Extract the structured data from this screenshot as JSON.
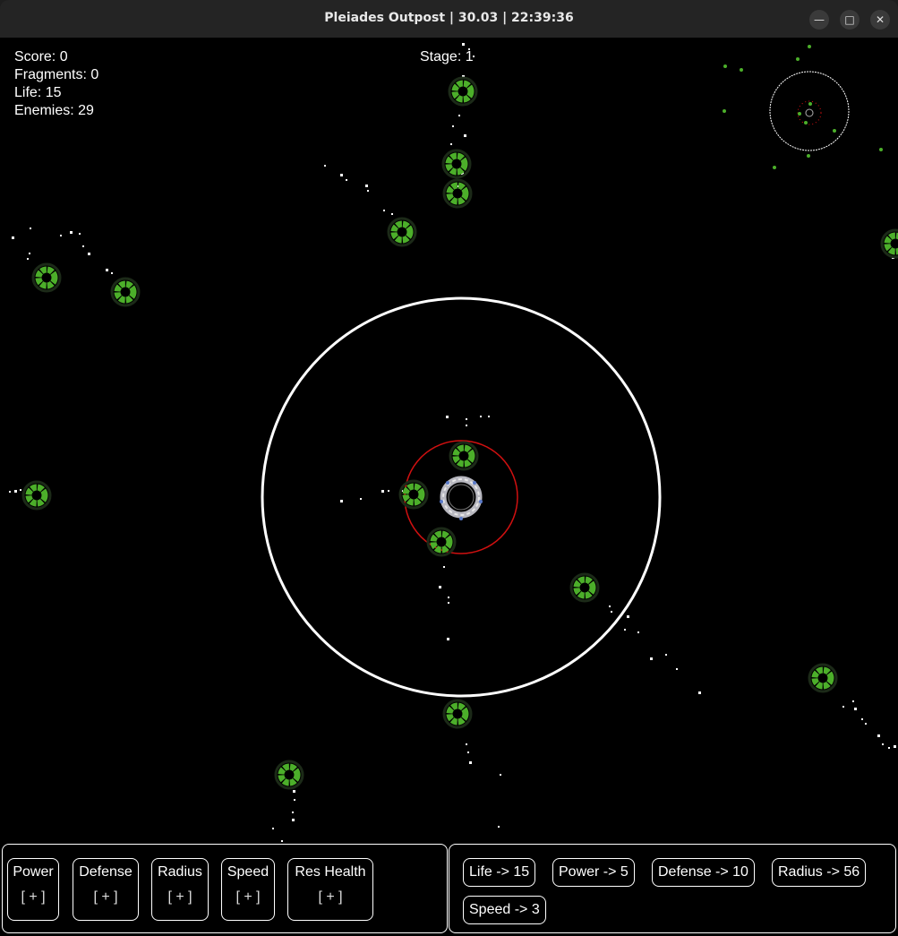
{
  "window": {
    "title": "Pleiades Outpost | 30.03 | 22:39:36",
    "controls": [
      "minimize",
      "maximize",
      "close"
    ]
  },
  "hud": {
    "score_label": "Score: 0",
    "fragments_label": "Fragments: 0",
    "life_label": "Life: 15",
    "enemies_label": "Enemies: 29",
    "stage_label": "Stage: 1"
  },
  "upgrades": [
    {
      "label": "Power",
      "button": "[ + ]"
    },
    {
      "label": "Defense",
      "button": "[ + ]"
    },
    {
      "label": "Radius",
      "button": "[ + ]"
    },
    {
      "label": "Speed",
      "button": "[ + ]"
    },
    {
      "label": "Res Health",
      "button": "[ + ]"
    }
  ],
  "stats": [
    {
      "label": "Life -> 15"
    },
    {
      "label": "Power -> 5"
    },
    {
      "label": "Defense -> 10"
    },
    {
      "label": "Radius -> 56"
    },
    {
      "label": "Speed -> 3"
    }
  ],
  "colors": {
    "enemy": "#4caf2a",
    "range_circle": "#ffffff",
    "defense_circle": "#d01010",
    "station": "#c8c8c8"
  }
}
